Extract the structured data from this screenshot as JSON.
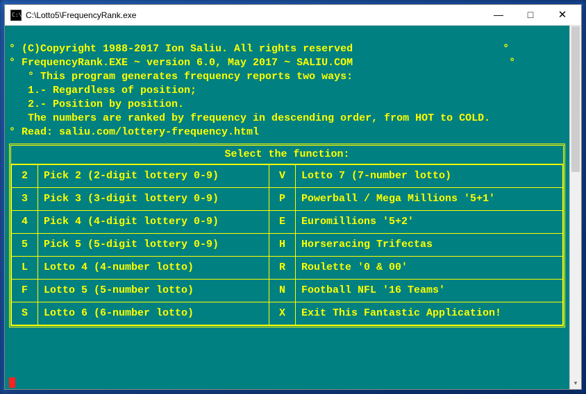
{
  "window": {
    "title": "C:\\Lotto5\\FrequencyRank.exe",
    "minimize": "—",
    "maximize": "□",
    "close": "✕"
  },
  "header_lines": [
    "° (C)Copyright 1988-2017 Ion Saliu. All rights reserved                        °",
    "° FrequencyRank.EXE ~ version 6.0, May 2017 ~ SALIU.COM                         °",
    "   ° This program generates frequency reports two ways:",
    "   1.- Regardless of position;",
    "   2.- Position by position.",
    "   The numbers are ranked by frequency in descending order, from HOT to COLD.",
    "° Read: saliu.com/lottery-frequency.html"
  ],
  "menu_title": "Select the function:",
  "rows": [
    {
      "k1": "2",
      "d1": "Pick 2 (2-digit lottery 0-9)",
      "k2": "V",
      "d2": "Lotto 7 (7-number lotto)"
    },
    {
      "k1": "3",
      "d1": "Pick 3 (3-digit lottery 0-9)",
      "k2": "P",
      "d2": "Powerball / Mega Millions '5+1'"
    },
    {
      "k1": "4",
      "d1": "Pick 4 (4-digit lottery 0-9)",
      "k2": "E",
      "d2": "Euromillions '5+2'"
    },
    {
      "k1": "5",
      "d1": "Pick 5 (5-digit lottery 0-9)",
      "k2": "H",
      "d2": "Horseracing Trifectas"
    },
    {
      "k1": "L",
      "d1": "Lotto 4 (4-number lotto)",
      "k2": "R",
      "d2": "Roulette '0 & 00'"
    },
    {
      "k1": "F",
      "d1": "Lotto 5 (5-number lotto)",
      "k2": "N",
      "d2": "Football NFL '16 Teams'"
    },
    {
      "k1": "S",
      "d1": "Lotto 6 (6-number lotto)",
      "k2": "X",
      "d2": "Exit This Fantastic Application!"
    }
  ],
  "colors": {
    "bg": "#008080",
    "fg": "#ffff00",
    "frame": "#2a6fd4",
    "cursor": "#ff2020"
  }
}
